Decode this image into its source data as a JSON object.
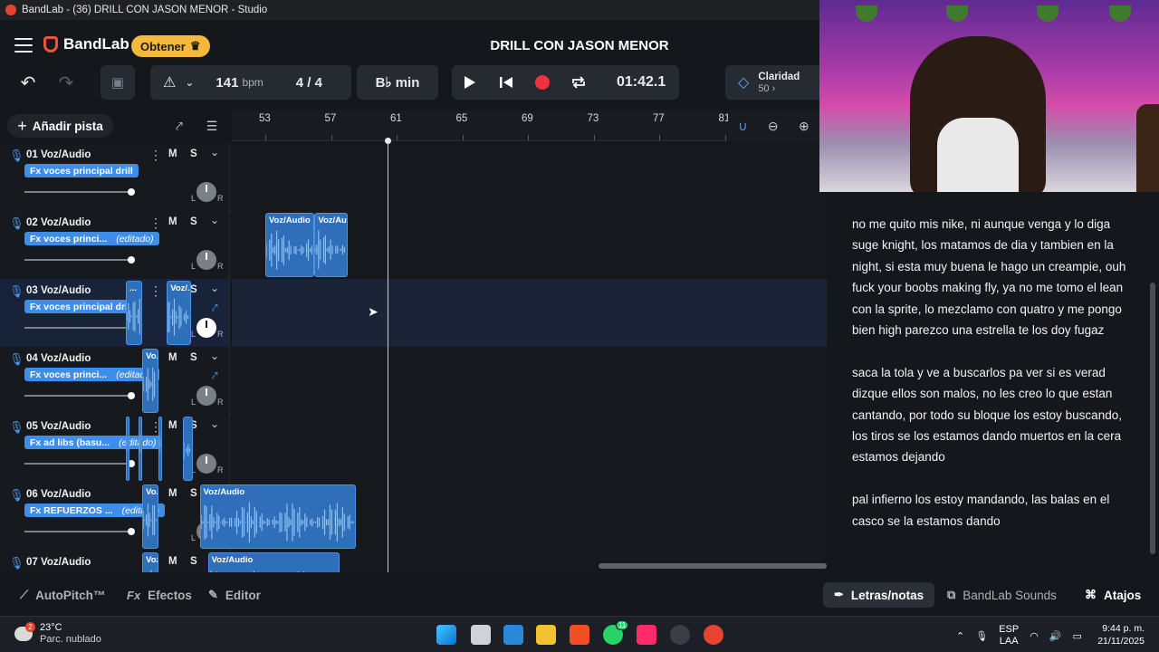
{
  "window": {
    "title": "BandLab - (36) DRILL CON JASON MENOR - Studio"
  },
  "header": {
    "logo": "BandLab",
    "obtener": "Obtener",
    "project_title": "DRILL CON JASON MENOR"
  },
  "transport": {
    "bpm": "141",
    "bpm_unit": "bpm",
    "time_signature": "4 / 4",
    "key": "B♭ min",
    "time": "01:42.1",
    "claridad_label": "Claridad",
    "claridad_value": "50"
  },
  "toolbar": {
    "add_track": "Añadir pista"
  },
  "ruler": {
    "ticks": [
      "53",
      "57",
      "61",
      "65",
      "69",
      "73",
      "77",
      "81"
    ]
  },
  "tracks": [
    {
      "number": "01",
      "name": "Voz/Audio",
      "fx": "Fx voces principal drill",
      "edited": "",
      "volume": 0.93,
      "pan": 0.5,
      "clips": []
    },
    {
      "number": "02",
      "name": "Voz/Audio",
      "fx": "Fx voces princi...",
      "edited": "(editado)",
      "volume": 0.93,
      "pan": 0.5,
      "clips": [
        {
          "label": "Voz/Audio",
          "start": 53.0,
          "end": 56.0
        },
        {
          "label": "Voz/Au...",
          "start": 56.0,
          "end": 58.0
        }
      ]
    },
    {
      "number": "03",
      "name": "Voz/Audio",
      "fx": "Fx voces principal drill",
      "edited": "",
      "volume": 0.93,
      "pan": 0.5,
      "selected": true,
      "clips": [
        {
          "label": "...",
          "start": 44.5,
          "end": 45.5
        },
        {
          "label": "Voz/...",
          "start": 47.0,
          "end": 48.5
        }
      ]
    },
    {
      "number": "04",
      "name": "Voz/Audio",
      "fx": "Fx voces princi...",
      "edited": "(editado)",
      "volume": 0.93,
      "pan": 0.5,
      "clips": [
        {
          "label": "Vo...",
          "start": 45.5,
          "end": 46.5
        }
      ]
    },
    {
      "number": "05",
      "name": "Voz/Audio",
      "fx": "Fx ad libs (basu...",
      "edited": "(editado)",
      "volume": 0.93,
      "pan": 0.5,
      "clips": [
        {
          "label": "",
          "start": 44.5,
          "end": 44.7
        },
        {
          "label": "",
          "start": 45.3,
          "end": 45.5
        },
        {
          "label": "",
          "start": 46.5,
          "end": 46.7
        },
        {
          "label": "",
          "start": 48.0,
          "end": 48.6
        }
      ]
    },
    {
      "number": "06",
      "name": "Voz/Audio",
      "fx": "Fx REFUERZOS ...",
      "edited": "(editado)",
      "volume": 0.93,
      "pan": 0.5,
      "clips": [
        {
          "label": "Vo...",
          "start": 45.5,
          "end": 46.5
        },
        {
          "label": "Voz/Audio",
          "start": 49.0,
          "end": 58.5
        }
      ]
    },
    {
      "number": "07",
      "name": "Voz/Audio",
      "fx": "",
      "edited": "",
      "volume": 0.93,
      "pan": 0.5,
      "clips": [
        {
          "label": "Voz...",
          "start": 45.5,
          "end": 46.5
        },
        {
          "label": "Voz/Audio",
          "start": 49.5,
          "end": 57.5
        }
      ]
    }
  ],
  "bottom": {
    "autopitch": "AutoPitch™",
    "efectos": "Efectos",
    "editor": "Editor",
    "lyrics": "Letras/notas",
    "sounds": "BandLab Sounds",
    "atajos": "Atajos"
  },
  "lyrics": [
    "no me quito mis nike, ni aunque venga y lo diga suge knight, los matamos de dia y tambien en la night, si esta muy buena le hago un creampie, ouh fuck your boobs making fly, ya no me tomo el lean con la sprite, lo mezclamo con quatro y me pongo bien high parezco una estrella te los doy fugaz",
    "saca la tola y ve a buscarlos pa ver si es verad dizque ellos son malos, no les creo lo que estan cantando, por todo su bloque los estoy buscando, los tiros se los estamos dando muertos en la cera estamos dejando",
    "pal infierno los estoy mandando, las balas en el casco se la estamos dando"
  ],
  "taskbar": {
    "temp": "23°C",
    "weather": "Parc. nublado",
    "lang1": "ESP",
    "lang2": "LAA",
    "time": "9:44 p. m.",
    "date": "21/11/2025",
    "notif_count": "2",
    "wa_count": "11"
  },
  "colors": {
    "accent": "#3d8de9",
    "clip": "#2f6fb9",
    "record": "#f0313f",
    "brand": "#f0533b",
    "obtener": "#f4b83a"
  }
}
